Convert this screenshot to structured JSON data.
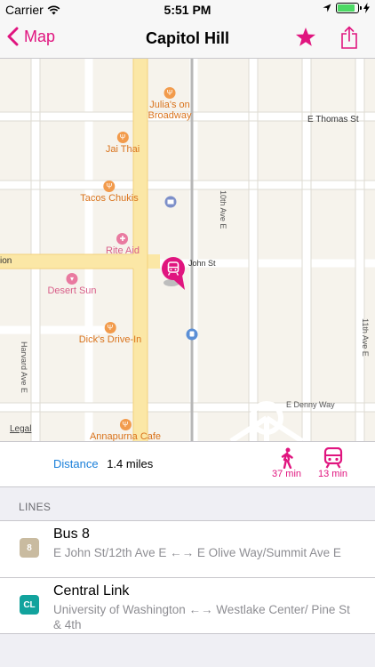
{
  "status_bar": {
    "carrier": "Carrier",
    "time": "5:51 PM",
    "battery_level": 0.9
  },
  "nav": {
    "back_label": "Map",
    "title": "Capitol Hill",
    "favorite_icon": "star-icon",
    "share_icon": "share-icon"
  },
  "colors": {
    "accent": "#e0157f",
    "link": "#1a7fd9"
  },
  "map": {
    "pois": [
      {
        "label": "Julia's on\nBroadway",
        "icon": "restaurant-icon"
      },
      {
        "label": "Jai Thai",
        "icon": "restaurant-icon"
      },
      {
        "label": "Tacos Chukis",
        "icon": "restaurant-icon"
      },
      {
        "label": "Rite Aid",
        "icon": "pharmacy-icon"
      },
      {
        "label": "Desert Sun",
        "icon": "clothing-icon"
      },
      {
        "label": "Dick's Drive-In",
        "icon": "restaurant-icon"
      },
      {
        "label": "Annapurna Cafe",
        "icon": "restaurant-icon"
      }
    ],
    "streets": {
      "e_thomas": "E Thomas St",
      "john": "John St",
      "tenth": "10th Ave E",
      "harvard": "Harvard Ave E",
      "eleventh": "11th Ave E",
      "denny": "E Denny Way",
      "ion": "ion"
    },
    "legal": "Legal"
  },
  "info": {
    "distance_label": "Distance",
    "distance_value": "1.4 miles",
    "walk_time": "37 min",
    "transit_time": "13 min"
  },
  "lines": {
    "header": "LINES",
    "items": [
      {
        "badge": "8",
        "name": "Bus 8",
        "description": "E John St/12th Ave E ←→ E Olive Way/Summit Ave E",
        "color": "#c9bba0"
      },
      {
        "badge": "CL",
        "name": "Central Link",
        "description": "University of Washington ←→ Westlake Center/ Pine St & 4th",
        "color": "#12a39d"
      }
    ]
  }
}
